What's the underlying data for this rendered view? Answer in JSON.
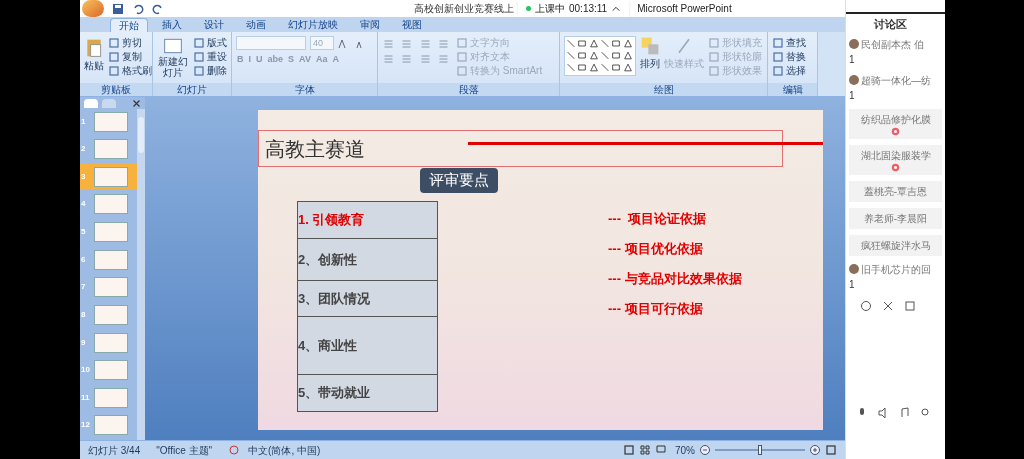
{
  "window": {
    "title": "高校创新创业竞赛线上",
    "app_name": "Microsoft PowerPoint"
  },
  "timer": {
    "status": "上课中",
    "time": "00:13:11",
    "live": true
  },
  "tabs": [
    {
      "label": "开始",
      "selected": true
    },
    {
      "label": "插入",
      "selected": false
    },
    {
      "label": "设计",
      "selected": false
    },
    {
      "label": "动画",
      "selected": false
    },
    {
      "label": "幻灯片放映",
      "selected": false
    },
    {
      "label": "审阅",
      "selected": false
    },
    {
      "label": "视图",
      "selected": false
    }
  ],
  "ribbon": {
    "clipboard": {
      "title": "剪贴板",
      "paste": "粘贴",
      "items": [
        "剪切",
        "复制",
        "格式刷"
      ]
    },
    "slides": {
      "title": "幻灯片",
      "new_slide": "新建幻灯片",
      "items": [
        "版式",
        "重设",
        "删除"
      ]
    },
    "font": {
      "title": "字体",
      "size": "40",
      "format_buttons": [
        "B",
        "I",
        "U",
        "abe",
        "S",
        "AV",
        "Aa",
        "A"
      ]
    },
    "paragraph": {
      "title": "段落",
      "items": [
        {
          "label": "文字方向",
          "disabled": true
        },
        {
          "label": "对齐文本",
          "disabled": true
        },
        {
          "label": "转换为 SmartArt",
          "disabled": true
        }
      ]
    },
    "drawing": {
      "title": "绘图",
      "arrange": "排列",
      "quick_styles": {
        "label": "快速样式",
        "disabled": true
      },
      "items": [
        {
          "label": "形状填充",
          "disabled": true
        },
        {
          "label": "形状轮廓",
          "disabled": true
        },
        {
          "label": "形状效果",
          "disabled": true
        }
      ]
    },
    "editing": {
      "title": "编辑",
      "items": [
        "查找",
        "替换",
        "选择"
      ]
    }
  },
  "slide_panel": [
    {
      "number": "1",
      "selected": false
    },
    {
      "number": "2",
      "selected": false
    },
    {
      "number": "3",
      "selected": true
    },
    {
      "number": "4",
      "selected": false
    },
    {
      "number": "5",
      "selected": false
    },
    {
      "number": "6",
      "selected": false
    },
    {
      "number": "7",
      "selected": false
    },
    {
      "number": "8",
      "selected": false
    },
    {
      "number": "9",
      "selected": false
    },
    {
      "number": "10",
      "selected": false
    },
    {
      "number": "11",
      "selected": false
    },
    {
      "number": "12",
      "selected": false
    }
  ],
  "slide": {
    "title": "高教主赛道",
    "badge": "评审要点",
    "criteria": [
      {
        "label": "1. 引领教育",
        "highlighted": true
      },
      {
        "label": "2、创新性",
        "highlighted": false
      },
      {
        "label": "3、团队情况",
        "highlighted": false
      },
      {
        "label": "4、商业性",
        "highlighted": false
      },
      {
        "label": "5、带动就业",
        "highlighted": false
      }
    ],
    "notes": [
      "---  项目论证依据",
      "--- 项目优化依据",
      "--- 与竞品对比效果依据",
      "--- 项目可行依据"
    ]
  },
  "status_bar": {
    "slide": "幻灯片 3/44",
    "theme": "\"Office 主题\"",
    "language": "中文(简体, 中国)",
    "zoom": "70%",
    "zoom_slider": {
      "level": 0.5
    }
  },
  "chat": {
    "title": "讨论区",
    "messages": [
      {
        "kind": "user",
        "text": "民创副本杰 伯",
        "count": "1"
      },
      {
        "kind": "user",
        "text": "超骑一体化—纺",
        "count": "1"
      },
      {
        "kind": "gift",
        "text": "纺织品修护化膜",
        "flower": true
      },
      {
        "kind": "gift",
        "text": "湖北固染服装学",
        "flower": true
      },
      {
        "kind": "gift",
        "text": "蓋桃亮-覃吉恩",
        "flower": false
      },
      {
        "kind": "gift",
        "text": "养老师-李晨阳",
        "flower": false
      },
      {
        "kind": "gift",
        "text": "疯狂螺旋泮水马",
        "flower": false
      },
      {
        "kind": "user",
        "text": "旧手机芯片的回",
        "count": "1"
      }
    ]
  }
}
